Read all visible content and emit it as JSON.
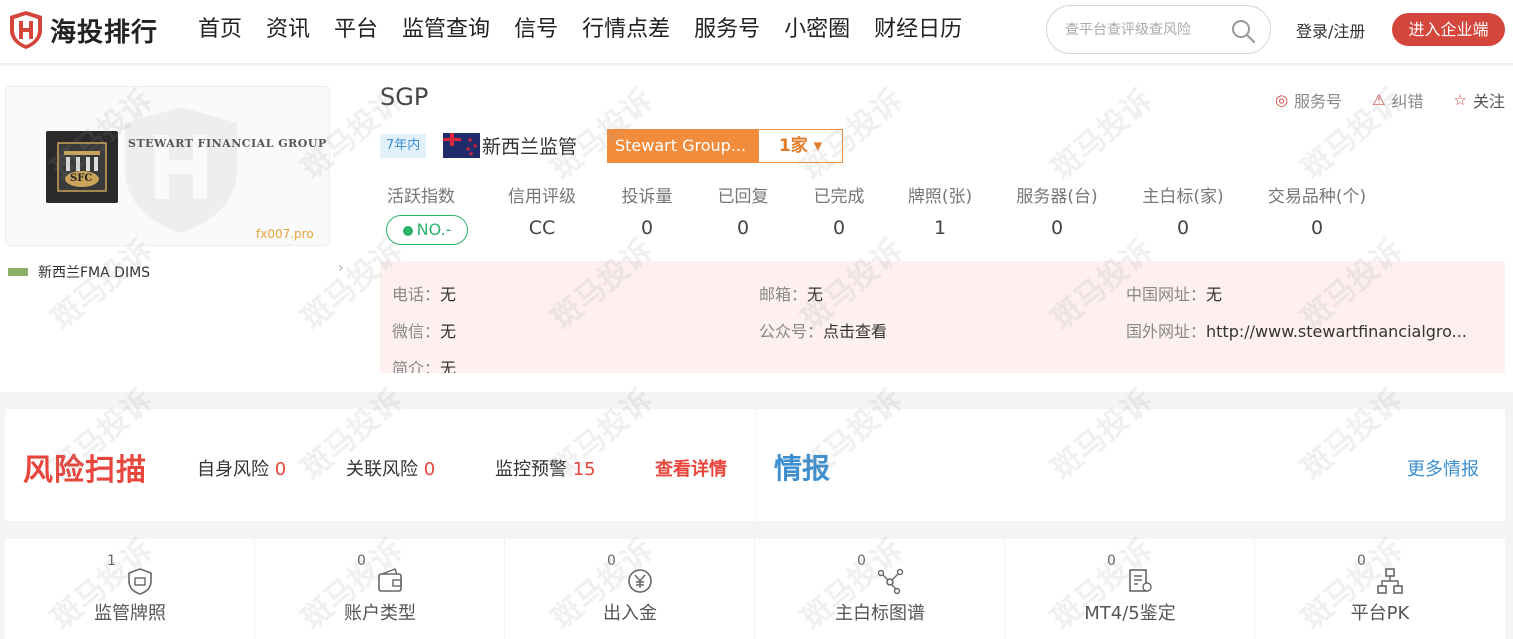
{
  "header": {
    "logo_text": "海投排行",
    "nav": [
      "首页",
      "资讯",
      "平台",
      "监管查询",
      "信号",
      "行情点差",
      "服务号",
      "小密圈",
      "财经日历"
    ],
    "search_placeholder": "查平台查评级查风险",
    "login_label": "登录/注册",
    "enterprise_label": "进入企业端"
  },
  "broker": {
    "name": "SGP",
    "logo_company_text": "STEWART FINANCIAL GROUP",
    "logo_badge_text": "SFC",
    "logo_watermark": "fx007.pro",
    "regulator_row": "新西兰FMA DIMS",
    "years_tag": "7年内",
    "regulator_label": "新西兰监管",
    "group_name": "Stewart Group...",
    "group_count": "1家 ▾",
    "actions": [
      "服务号",
      "纠错",
      "关注"
    ]
  },
  "stats": [
    {
      "label": "活跃指数",
      "value": "NO.-"
    },
    {
      "label": "信用评级",
      "value": "CC"
    },
    {
      "label": "投诉量",
      "value": "0"
    },
    {
      "label": "已回复",
      "value": "0"
    },
    {
      "label": "已完成",
      "value": "0"
    },
    {
      "label": "牌照(张)",
      "value": "1"
    },
    {
      "label": "服务器(台)",
      "value": "0"
    },
    {
      "label": "主白标(家)",
      "value": "0"
    },
    {
      "label": "交易品种(个)",
      "value": "0"
    }
  ],
  "contact": {
    "phone_k": "电话：",
    "phone_v": "无",
    "email_k": "邮箱：",
    "email_v": "无",
    "cn_site_k": "中国网址：",
    "cn_site_v": "无",
    "wechat_k": "微信：",
    "wechat_v": "无",
    "official_k": "公众号：",
    "official_v": "点击查看",
    "foreign_site_k": "国外网址：",
    "foreign_site_v": "http://www.stewartfinancialgro...",
    "intro_k": "简介：",
    "intro_v": "无"
  },
  "risk": {
    "title": "风险扫描",
    "self_label": "自身风险",
    "self_count": "0",
    "related_label": "关联风险",
    "related_count": "0",
    "monitor_label": "监控预警",
    "monitor_count": "15",
    "detail_link": "查看详情"
  },
  "intel": {
    "title": "情报",
    "more_link": "更多情报"
  },
  "tabs": [
    {
      "count": "1",
      "label": "监管牌照",
      "icon": "shield-license-icon"
    },
    {
      "count": "0",
      "label": "账户类型",
      "icon": "wallet-icon"
    },
    {
      "count": "0",
      "label": "出入金",
      "icon": "yuan-coin-icon"
    },
    {
      "count": "0",
      "label": "主白标图谱",
      "icon": "graph-nodes-icon"
    },
    {
      "count": "0",
      "label": "MT4/5鉴定",
      "icon": "document-check-icon"
    },
    {
      "count": "0",
      "label": "平台PK",
      "icon": "hierarchy-icon"
    }
  ],
  "watermark_text": "斑马投诉",
  "colors": {
    "brand_red": "#d4463b",
    "orange": "#f08c3c",
    "green": "#2bb36a",
    "blue": "#3d8fd0"
  }
}
